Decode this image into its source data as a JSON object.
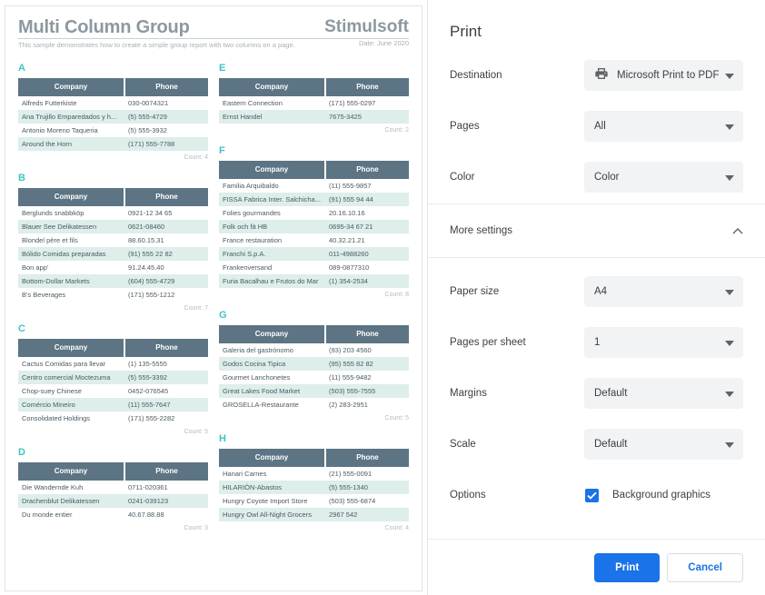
{
  "report": {
    "title": "Multi Column Group",
    "brand": "Stimulsoft",
    "subtitle": "This sample demonstrates how to create a simple group report with two columns on a page.",
    "date": "Date: June 2020",
    "columns": {
      "company": "Company",
      "phone": "Phone"
    },
    "count_prefix": "Count: ",
    "left_groups": [
      {
        "letter": "A",
        "rows": [
          {
            "company": "Alfreds Futterkiste",
            "phone": "030-0074321"
          },
          {
            "company": "Ana Trujillo Emparedados y h...",
            "phone": "(5) 555-4729"
          },
          {
            "company": "Antonio Moreno Taqueria",
            "phone": "(5) 555-3932"
          },
          {
            "company": "Around the Horn",
            "phone": "(171) 555-7788"
          }
        ],
        "count": "Count: 4"
      },
      {
        "letter": "B",
        "rows": [
          {
            "company": "Berglunds snabbköp",
            "phone": "0921-12 34 65"
          },
          {
            "company": "Blauer See Delikatessen",
            "phone": "0621-08460"
          },
          {
            "company": "Blondel père et fils",
            "phone": "88.60.15.31"
          },
          {
            "company": "Bólido Comidas preparadas",
            "phone": "(91) 555 22 82"
          },
          {
            "company": "Bon app'",
            "phone": "91.24.45.40"
          },
          {
            "company": "Bottom-Dollar Markets",
            "phone": "(604) 555-4729"
          },
          {
            "company": "B's Beverages",
            "phone": "(171) 555-1212"
          }
        ],
        "count": "Count: 7"
      },
      {
        "letter": "C",
        "rows": [
          {
            "company": "Cactus Comidas para llevar",
            "phone": "(1) 135-5555"
          },
          {
            "company": "Centro comercial Moctezuma",
            "phone": "(5) 555-3392"
          },
          {
            "company": "Chop-suey Chinese",
            "phone": "0452-076545"
          },
          {
            "company": "Comércio Mineiro",
            "phone": "(11) 555-7647"
          },
          {
            "company": "Consolidated Holdings",
            "phone": "(171) 555-2282"
          }
        ],
        "count": "Count: 5"
      },
      {
        "letter": "D",
        "rows": [
          {
            "company": "Die Wandernde Kuh",
            "phone": "0711-020361"
          },
          {
            "company": "Drachenblut Delikatessen",
            "phone": "0241-039123"
          },
          {
            "company": "Du monde entier",
            "phone": "40.67.88.88"
          }
        ],
        "count": "Count: 3"
      }
    ],
    "right_groups": [
      {
        "letter": "E",
        "rows": [
          {
            "company": "Eastern Connection",
            "phone": "(171) 555-0297"
          },
          {
            "company": "Ernst Handel",
            "phone": "7675-3425"
          }
        ],
        "count": "Count: 2"
      },
      {
        "letter": "F",
        "rows": [
          {
            "company": "Familia Arquibaldo",
            "phone": "(11) 555-9857"
          },
          {
            "company": "FISSA Fabrica Inter. Salchicha...",
            "phone": "(91) 555 94 44"
          },
          {
            "company": "Folies gourmandes",
            "phone": "20.16.10.16"
          },
          {
            "company": "Folk och fä HB",
            "phone": "0695-34 67 21"
          },
          {
            "company": "France restauration",
            "phone": "40.32.21.21"
          },
          {
            "company": "Franchi S.p.A.",
            "phone": "011-4988260"
          },
          {
            "company": "Frankenversand",
            "phone": "089-0877310"
          },
          {
            "company": "Furia Bacalhau e Frutos do Mar",
            "phone": "(1) 354-2534"
          }
        ],
        "count": "Count: 8"
      },
      {
        "letter": "G",
        "rows": [
          {
            "company": "Galeria del gastrónomo",
            "phone": "(93) 203 4560"
          },
          {
            "company": "Godos Cocina Tipica",
            "phone": "(95) 555 82 82"
          },
          {
            "company": "Gourmet Lanchonetes",
            "phone": "(11) 555-9482"
          },
          {
            "company": "Great Lakes Food Market",
            "phone": "(503) 555-7555"
          },
          {
            "company": "GROSELLA-Restaurante",
            "phone": "(2) 283-2951"
          }
        ],
        "count": "Count: 5"
      },
      {
        "letter": "H",
        "rows": [
          {
            "company": "Hanari Carnes",
            "phone": "(21) 555-0091"
          },
          {
            "company": "HILARIÓN-Abastos",
            "phone": "(5) 555-1340"
          },
          {
            "company": "Hungry Coyote Import Store",
            "phone": "(503) 555-6874"
          },
          {
            "company": "Hungry Owl All-Night Grocers",
            "phone": "2967 542"
          }
        ],
        "count": "Count: 4"
      }
    ]
  },
  "print_dialog": {
    "title": "Print",
    "destination": {
      "label": "Destination",
      "value": "Microsoft Print to PDF",
      "icon": "printer-icon"
    },
    "pages": {
      "label": "Pages",
      "value": "All"
    },
    "color": {
      "label": "Color",
      "value": "Color"
    },
    "more_settings": {
      "label": "More settings",
      "icon": "chevron-up-icon"
    },
    "paper_size": {
      "label": "Paper size",
      "value": "A4"
    },
    "pages_per_sheet": {
      "label": "Pages per sheet",
      "value": "1"
    },
    "margins": {
      "label": "Margins",
      "value": "Default"
    },
    "scale": {
      "label": "Scale",
      "value": "Default"
    },
    "options": {
      "label": "Options",
      "checkbox_label": "Background graphics",
      "checked": true
    },
    "buttons": {
      "print": "Print",
      "cancel": "Cancel"
    },
    "colors": {
      "accent": "#1a73e8",
      "field_bg": "#f1f3f4",
      "text": "#3c4043"
    }
  },
  "theme": {
    "table_header_bg": "#5c7483",
    "table_alt_row_bg": "#ddeeeb",
    "group_letter_color": "#3fc3c6",
    "report_title_color": "#8d98a0"
  }
}
